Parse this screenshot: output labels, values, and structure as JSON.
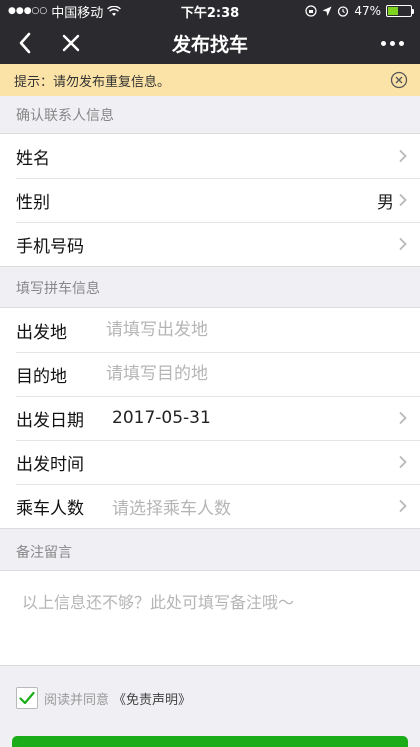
{
  "status_bar": {
    "signal": "●●●○○",
    "carrier": "中国移动",
    "time": "下午2:38",
    "battery_percent": "47%",
    "battery_level": 0.47
  },
  "nav": {
    "title": "发布找车"
  },
  "notice": {
    "text": "提示：请勿发布重复信息。"
  },
  "contact_section": {
    "header": "确认联系人信息",
    "rows": [
      {
        "label": "姓名",
        "value": ""
      },
      {
        "label": "性别",
        "value": "男"
      },
      {
        "label": "手机号码",
        "value": ""
      }
    ]
  },
  "trip_section": {
    "header": "填写拼车信息",
    "rows": [
      {
        "label": "出发地",
        "placeholder": "请填写出发地"
      },
      {
        "label": "目的地",
        "placeholder": "请填写目的地"
      },
      {
        "label": "出发日期",
        "value": "2017-05-31"
      },
      {
        "label": "出发时间",
        "value": ""
      },
      {
        "label": "乘车人数",
        "placeholder": "请选择乘车人数"
      }
    ]
  },
  "remark_section": {
    "header": "备注留言",
    "placeholder": "以上信息还不够？此处可填写备注哦～"
  },
  "agreement": {
    "text": "阅读并同意",
    "link": "《免责声明》",
    "checked": true
  },
  "colors": {
    "nav_bg": "#2b2b2f",
    "notice_bg": "#fbe3a7",
    "accent_green": "#1aad19"
  }
}
